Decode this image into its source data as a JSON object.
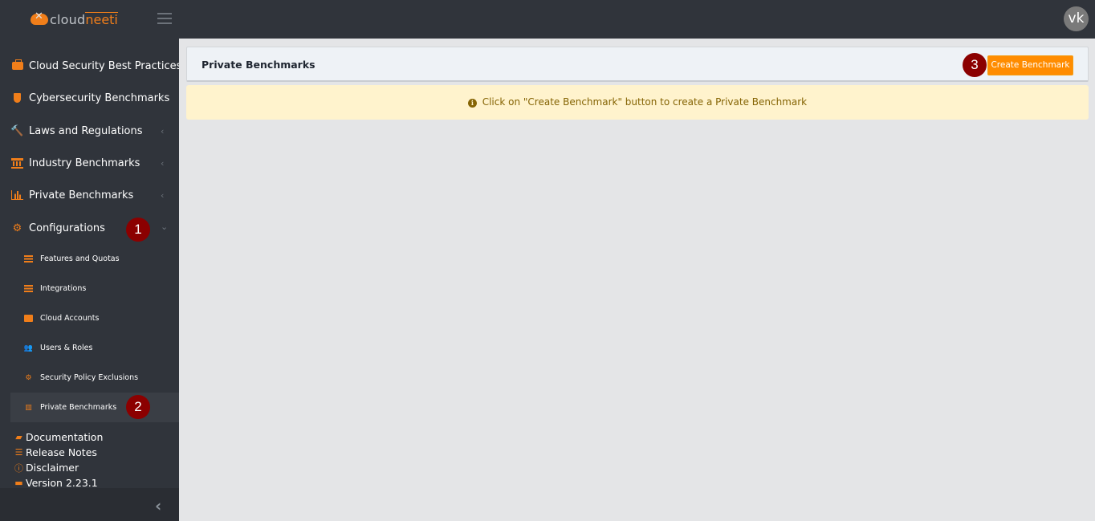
{
  "app": {
    "logo_left": "cloud",
    "logo_right": "neeti",
    "user_initials": "vk"
  },
  "sidebar": {
    "items": [
      {
        "label": "Cloud Security Best Practices",
        "icon": "briefcase-icon",
        "has_chevron": false
      },
      {
        "label": "Cybersecurity Benchmarks",
        "icon": "shield-icon",
        "has_chevron": true,
        "chevron": "‹"
      },
      {
        "label": "Laws and Regulations",
        "icon": "gavel-icon",
        "has_chevron": true,
        "chevron": "‹"
      },
      {
        "label": "Industry Benchmarks",
        "icon": "bank-icon",
        "has_chevron": true,
        "chevron": "‹"
      },
      {
        "label": "Private Benchmarks",
        "icon": "bar-chart-icon",
        "has_chevron": true,
        "chevron": "‹"
      },
      {
        "label": "Configurations",
        "icon": "gear-icon",
        "has_chevron": true,
        "chevron": "⌄",
        "expanded": true
      }
    ],
    "sub_items": [
      {
        "label": "Features and Quotas",
        "icon": "list-icon"
      },
      {
        "label": "Integrations",
        "icon": "list-icon"
      },
      {
        "label": "Cloud Accounts",
        "icon": "id-card-icon"
      },
      {
        "label": "Users & Roles",
        "icon": "users-icon"
      },
      {
        "label": "Security Policy Exclusions",
        "icon": "cogs-icon"
      },
      {
        "label": "Private Benchmarks",
        "icon": "columns-icon",
        "active": true
      }
    ],
    "footer_links": [
      {
        "label": "Documentation",
        "icon": "book-icon"
      },
      {
        "label": "Release Notes",
        "icon": "list-icon"
      },
      {
        "label": "Disclaimer",
        "icon": "exclamation-circle-icon"
      },
      {
        "label": "Version 2.23.1",
        "icon": "id-card-icon"
      }
    ],
    "collapse_glyph": "‹"
  },
  "annotations": {
    "badge_1": "1",
    "badge_2": "2",
    "badge_3": "3"
  },
  "main": {
    "title": "Private Benchmarks",
    "create_button": "Create Benchmark",
    "alert_text": "Click on \"Create Benchmark\" button to create a Private Benchmark",
    "alert_icon": "i"
  },
  "colors": {
    "accent": "#f07e1a",
    "button": "#ff8c00",
    "sidebar_bg": "#30343b",
    "badge": "#8b0000",
    "alert_bg": "#fff3cd",
    "alert_text": "#856404"
  }
}
